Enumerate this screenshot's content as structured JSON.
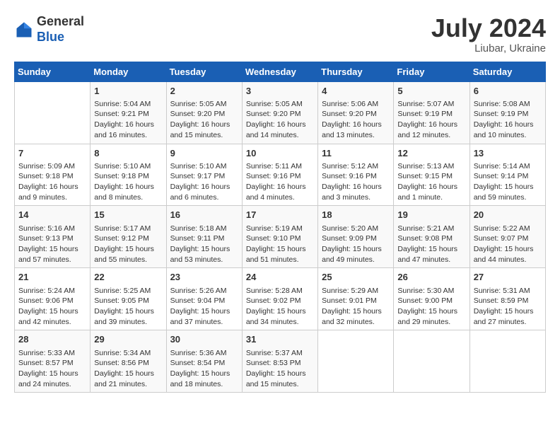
{
  "header": {
    "logo_general": "General",
    "logo_blue": "Blue",
    "month_title": "July 2024",
    "subtitle": "Liubar, Ukraine"
  },
  "weekdays": [
    "Sunday",
    "Monday",
    "Tuesday",
    "Wednesday",
    "Thursday",
    "Friday",
    "Saturday"
  ],
  "weeks": [
    [
      {
        "day": "",
        "info": ""
      },
      {
        "day": "1",
        "info": "Sunrise: 5:04 AM\nSunset: 9:21 PM\nDaylight: 16 hours\nand 16 minutes."
      },
      {
        "day": "2",
        "info": "Sunrise: 5:05 AM\nSunset: 9:20 PM\nDaylight: 16 hours\nand 15 minutes."
      },
      {
        "day": "3",
        "info": "Sunrise: 5:05 AM\nSunset: 9:20 PM\nDaylight: 16 hours\nand 14 minutes."
      },
      {
        "day": "4",
        "info": "Sunrise: 5:06 AM\nSunset: 9:20 PM\nDaylight: 16 hours\nand 13 minutes."
      },
      {
        "day": "5",
        "info": "Sunrise: 5:07 AM\nSunset: 9:19 PM\nDaylight: 16 hours\nand 12 minutes."
      },
      {
        "day": "6",
        "info": "Sunrise: 5:08 AM\nSunset: 9:19 PM\nDaylight: 16 hours\nand 10 minutes."
      }
    ],
    [
      {
        "day": "7",
        "info": "Sunrise: 5:09 AM\nSunset: 9:18 PM\nDaylight: 16 hours\nand 9 minutes."
      },
      {
        "day": "8",
        "info": "Sunrise: 5:10 AM\nSunset: 9:18 PM\nDaylight: 16 hours\nand 8 minutes."
      },
      {
        "day": "9",
        "info": "Sunrise: 5:10 AM\nSunset: 9:17 PM\nDaylight: 16 hours\nand 6 minutes."
      },
      {
        "day": "10",
        "info": "Sunrise: 5:11 AM\nSunset: 9:16 PM\nDaylight: 16 hours\nand 4 minutes."
      },
      {
        "day": "11",
        "info": "Sunrise: 5:12 AM\nSunset: 9:16 PM\nDaylight: 16 hours\nand 3 minutes."
      },
      {
        "day": "12",
        "info": "Sunrise: 5:13 AM\nSunset: 9:15 PM\nDaylight: 16 hours\nand 1 minute."
      },
      {
        "day": "13",
        "info": "Sunrise: 5:14 AM\nSunset: 9:14 PM\nDaylight: 15 hours\nand 59 minutes."
      }
    ],
    [
      {
        "day": "14",
        "info": "Sunrise: 5:16 AM\nSunset: 9:13 PM\nDaylight: 15 hours\nand 57 minutes."
      },
      {
        "day": "15",
        "info": "Sunrise: 5:17 AM\nSunset: 9:12 PM\nDaylight: 15 hours\nand 55 minutes."
      },
      {
        "day": "16",
        "info": "Sunrise: 5:18 AM\nSunset: 9:11 PM\nDaylight: 15 hours\nand 53 minutes."
      },
      {
        "day": "17",
        "info": "Sunrise: 5:19 AM\nSunset: 9:10 PM\nDaylight: 15 hours\nand 51 minutes."
      },
      {
        "day": "18",
        "info": "Sunrise: 5:20 AM\nSunset: 9:09 PM\nDaylight: 15 hours\nand 49 minutes."
      },
      {
        "day": "19",
        "info": "Sunrise: 5:21 AM\nSunset: 9:08 PM\nDaylight: 15 hours\nand 47 minutes."
      },
      {
        "day": "20",
        "info": "Sunrise: 5:22 AM\nSunset: 9:07 PM\nDaylight: 15 hours\nand 44 minutes."
      }
    ],
    [
      {
        "day": "21",
        "info": "Sunrise: 5:24 AM\nSunset: 9:06 PM\nDaylight: 15 hours\nand 42 minutes."
      },
      {
        "day": "22",
        "info": "Sunrise: 5:25 AM\nSunset: 9:05 PM\nDaylight: 15 hours\nand 39 minutes."
      },
      {
        "day": "23",
        "info": "Sunrise: 5:26 AM\nSunset: 9:04 PM\nDaylight: 15 hours\nand 37 minutes."
      },
      {
        "day": "24",
        "info": "Sunrise: 5:28 AM\nSunset: 9:02 PM\nDaylight: 15 hours\nand 34 minutes."
      },
      {
        "day": "25",
        "info": "Sunrise: 5:29 AM\nSunset: 9:01 PM\nDaylight: 15 hours\nand 32 minutes."
      },
      {
        "day": "26",
        "info": "Sunrise: 5:30 AM\nSunset: 9:00 PM\nDaylight: 15 hours\nand 29 minutes."
      },
      {
        "day": "27",
        "info": "Sunrise: 5:31 AM\nSunset: 8:59 PM\nDaylight: 15 hours\nand 27 minutes."
      }
    ],
    [
      {
        "day": "28",
        "info": "Sunrise: 5:33 AM\nSunset: 8:57 PM\nDaylight: 15 hours\nand 24 minutes."
      },
      {
        "day": "29",
        "info": "Sunrise: 5:34 AM\nSunset: 8:56 PM\nDaylight: 15 hours\nand 21 minutes."
      },
      {
        "day": "30",
        "info": "Sunrise: 5:36 AM\nSunset: 8:54 PM\nDaylight: 15 hours\nand 18 minutes."
      },
      {
        "day": "31",
        "info": "Sunrise: 5:37 AM\nSunset: 8:53 PM\nDaylight: 15 hours\nand 15 minutes."
      },
      {
        "day": "",
        "info": ""
      },
      {
        "day": "",
        "info": ""
      },
      {
        "day": "",
        "info": ""
      }
    ]
  ]
}
